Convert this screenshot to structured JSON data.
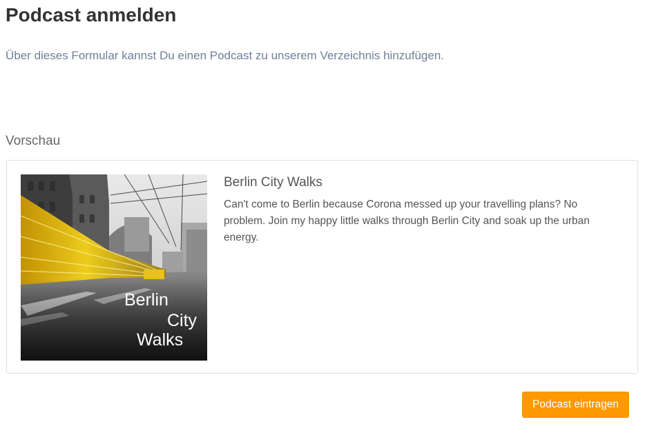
{
  "page": {
    "title": "Podcast anmelden",
    "intro": "Über dieses Formular kannst Du einen Podcast zu unserem Verzeichnis hinzufügen."
  },
  "preview": {
    "heading": "Vorschau",
    "podcast": {
      "title": "Berlin City Walks",
      "description": "Can't come to Berlin because Corona messed up your travelling plans? No problem. Join my happy little walks through Berlin City and soak up the urban energy.",
      "cover_text": [
        "Berlin",
        "City",
        "Walks"
      ]
    }
  },
  "actions": {
    "submit_label": "Podcast eintragen"
  },
  "colors": {
    "accent": "#ff9900",
    "intro_text": "#6f7f99",
    "tram_yellow": "#f2c200"
  }
}
